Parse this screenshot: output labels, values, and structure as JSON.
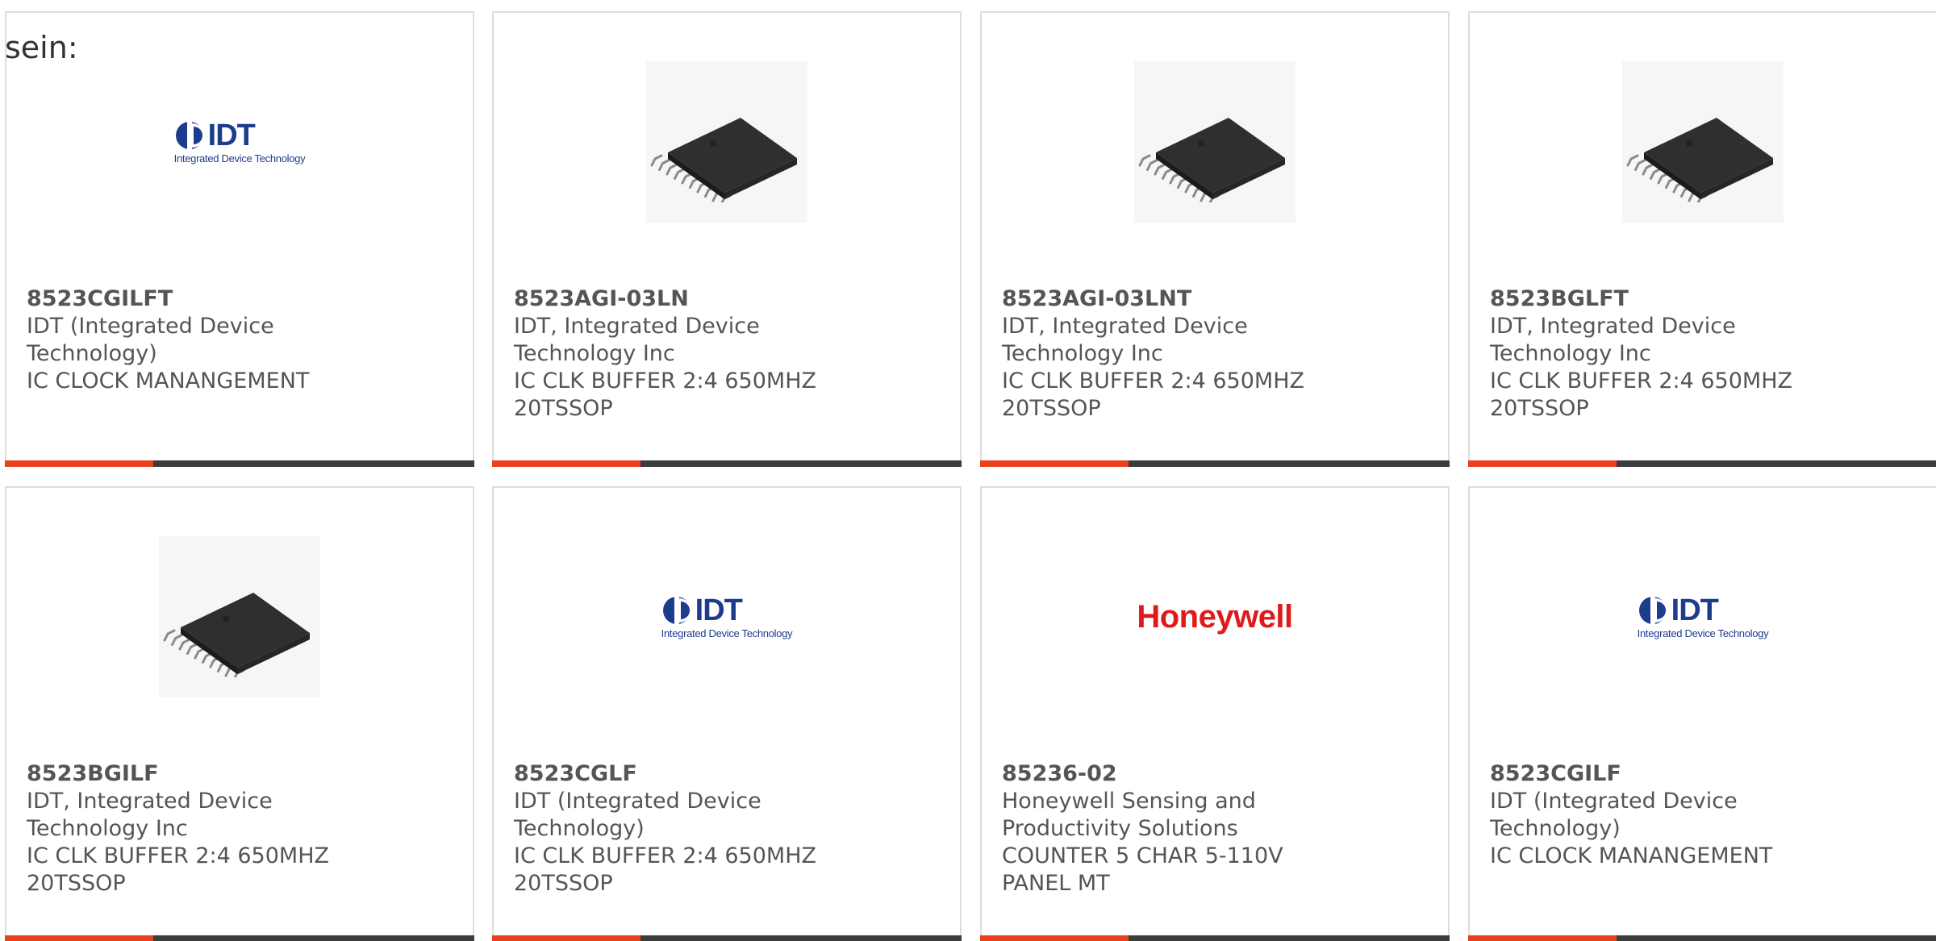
{
  "intro_text": "sein:",
  "colors": {
    "accent": "#e8401c",
    "bar_dark": "#3c3c3c",
    "idt_blue": "#1e3c8c",
    "honeywell_red": "#e01a1a"
  },
  "products": [
    {
      "part": "8523CGILFT",
      "manufacturer": "IDT (Integrated Device Technology)",
      "description": "IC CLOCK MANANGEMENT",
      "image": "idt-logo",
      "logo_main": "IDT",
      "logo_sub": "Integrated Device Technology"
    },
    {
      "part": "8523AGI-03LN",
      "manufacturer": "IDT, Integrated Device Technology Inc",
      "description": "IC CLK BUFFER 2:4 650MHZ 20TSSOP",
      "image": "tssop-chip"
    },
    {
      "part": "8523AGI-03LNT",
      "manufacturer": "IDT, Integrated Device Technology Inc",
      "description": "IC CLK BUFFER 2:4 650MHZ 20TSSOP",
      "image": "tssop-chip"
    },
    {
      "part": "8523BGLFT",
      "manufacturer": "IDT, Integrated Device Technology Inc",
      "description": "IC CLK BUFFER 2:4 650MHZ 20TSSOP",
      "image": "tssop-chip"
    },
    {
      "part": "8523BGILF",
      "manufacturer": "IDT, Integrated Device Technology Inc",
      "description": "IC CLK BUFFER 2:4 650MHZ 20TSSOP",
      "image": "tssop-chip"
    },
    {
      "part": "8523CGLF",
      "manufacturer": "IDT (Integrated Device Technology)",
      "description": "IC CLK BUFFER 2:4 650MHZ 20TSSOP",
      "image": "idt-logo",
      "logo_main": "IDT",
      "logo_sub": "Integrated Device Technology"
    },
    {
      "part": "85236-02",
      "manufacturer": "Honeywell Sensing and Productivity Solutions",
      "description": "COUNTER 5 CHAR 5-110V PANEL MT",
      "image": "honeywell-logo",
      "logo_main": "Honeywell"
    },
    {
      "part": "8523CGILF",
      "manufacturer": "IDT (Integrated Device Technology)",
      "description": "IC CLOCK MANANGEMENT",
      "image": "idt-logo",
      "logo_main": "IDT",
      "logo_sub": "Integrated Device Technology"
    }
  ]
}
